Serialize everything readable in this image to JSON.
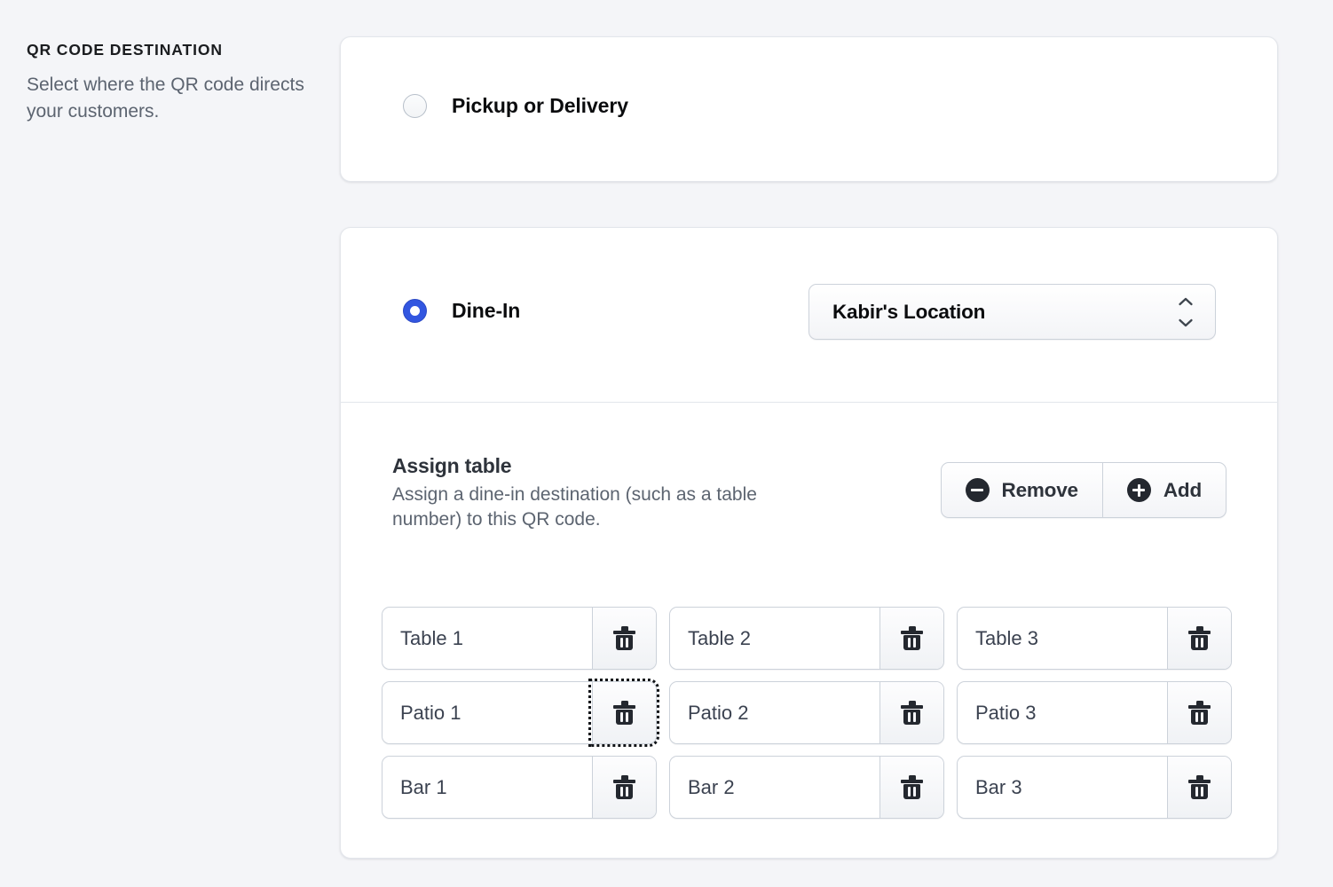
{
  "sidebar": {
    "title": "QR CODE DESTINATION",
    "description": "Select where the QR code directs your customers."
  },
  "pickup_card": {
    "radio_label": "Pickup or Delivery",
    "selected": false
  },
  "dinein_card": {
    "radio_label": "Dine-In",
    "selected": true,
    "location_select": {
      "value": "Kabir's Location",
      "icon": "stepper-updown-icon"
    }
  },
  "assign_section": {
    "title": "Assign table",
    "description": "Assign a dine-in destination (such as a table number) to this QR code.",
    "remove_label": "Remove",
    "add_label": "Add",
    "remove_icon": "minus-circle-icon",
    "add_icon": "plus-circle-icon",
    "delete_icon": "trash-icon"
  },
  "tables": [
    {
      "value": "Table 1",
      "focused": false
    },
    {
      "value": "Table 2",
      "focused": false
    },
    {
      "value": "Table 3",
      "focused": false
    },
    {
      "value": "Patio 1",
      "focused": true
    },
    {
      "value": "Patio 2",
      "focused": false
    },
    {
      "value": "Patio 3",
      "focused": false
    },
    {
      "value": "Bar 1",
      "focused": false
    },
    {
      "value": "Bar 2",
      "focused": false
    },
    {
      "value": "Bar 3",
      "focused": false
    }
  ],
  "colors": {
    "page_background": "#f4f5f8",
    "card_background": "#ffffff",
    "border": "#ccd2da",
    "accent_radio": "#3256e0",
    "text_primary": "#0b0c0e",
    "text_secondary": "#5c6470",
    "icon_dark": "#24282f"
  }
}
